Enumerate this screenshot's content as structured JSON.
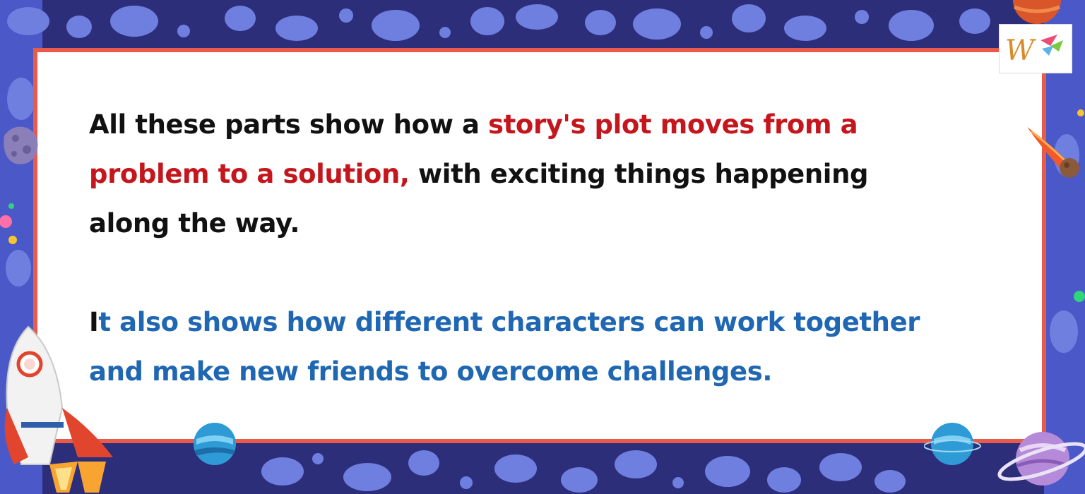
{
  "slide": {
    "paragraph1": {
      "part1": "All these parts show how a ",
      "highlight1": "story's plot moves from a",
      "highlight2": "problem to a solution,",
      "part2": " with exciting things happening",
      "part3": "along the way."
    },
    "paragraph2": {
      "lead": "I",
      "line1": "t also shows how different characters can work together",
      "line2": "and make new friends to overcome challenges."
    }
  },
  "colors": {
    "background": "#2d2e7a",
    "spots": "#6f7fe0",
    "card_border": "#ea5a4a",
    "highlight_red": "#c4161c",
    "highlight_blue": "#1f67b2"
  },
  "decorations": [
    "rocket-icon",
    "planet-icon",
    "ringed-planet-icon",
    "asteroid-icon",
    "comet-icon",
    "logo-icon"
  ]
}
